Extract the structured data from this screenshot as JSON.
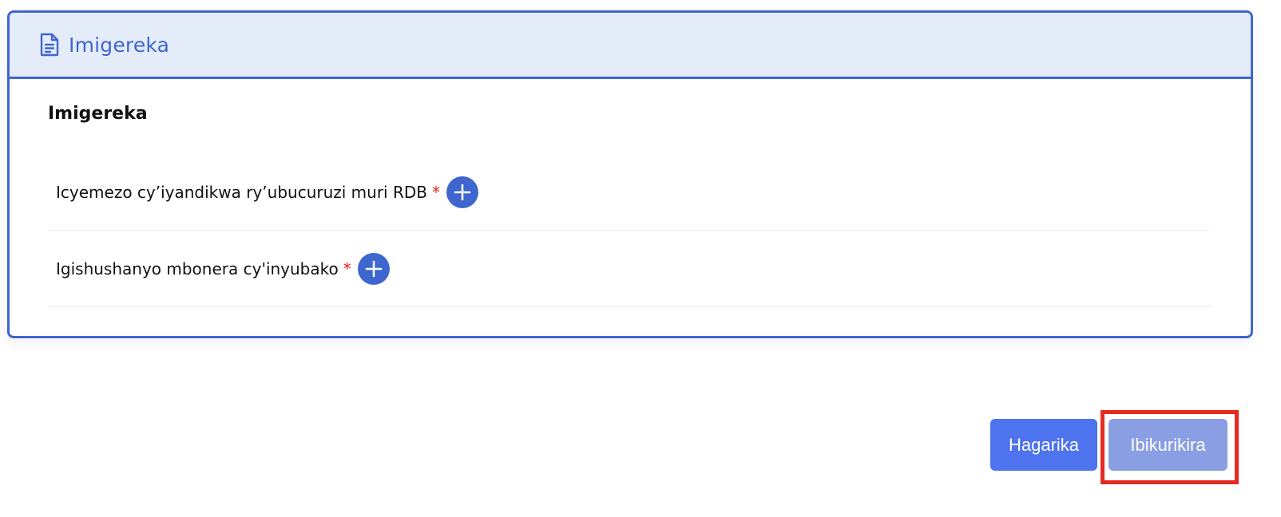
{
  "card": {
    "header_title": "Imigereka",
    "header_icon": "document-icon",
    "section_title": "Imigereka",
    "documents": [
      {
        "label": "Icyemezo cy’iyandikwa ry’ubucuruzi muri RDB",
        "required_mark": "*",
        "add_icon": "plus-icon"
      },
      {
        "label": "Igishushanyo mbonera cy'inyubako",
        "required_mark": "*",
        "add_icon": "plus-icon"
      }
    ]
  },
  "actions": {
    "cancel_label": "Hagarika",
    "submit_label": "Ibikurikira"
  },
  "colors": {
    "accent": "#3f66cf",
    "header_bg": "#e4ecfa",
    "required": "#e02424",
    "cancel_bg": "#4e73ef",
    "submit_bg": "#8a9fe3",
    "highlight": "#e52b21"
  }
}
